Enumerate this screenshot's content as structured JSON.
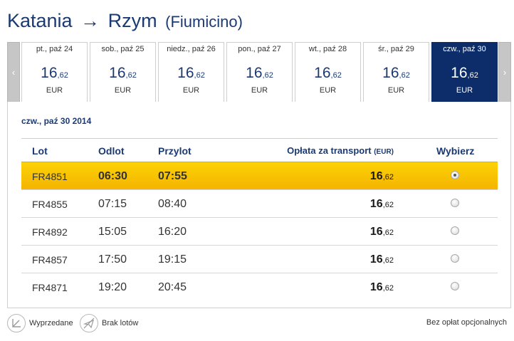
{
  "route": {
    "origin": "Katania",
    "arrow": "→",
    "destination": "Rzym",
    "airport": "(Fiumicino)"
  },
  "date_strip": {
    "prev_label": "‹",
    "next_label": "›",
    "days": [
      {
        "label": "pt., paź 24",
        "price_int": "16",
        "price_dec": ",62",
        "currency": "EUR",
        "selected": false
      },
      {
        "label": "sob., paź 25",
        "price_int": "16",
        "price_dec": ",62",
        "currency": "EUR",
        "selected": false
      },
      {
        "label": "niedz., paź 26",
        "price_int": "16",
        "price_dec": ",62",
        "currency": "EUR",
        "selected": false
      },
      {
        "label": "pon., paź 27",
        "price_int": "16",
        "price_dec": ",62",
        "currency": "EUR",
        "selected": false
      },
      {
        "label": "wt., paź 28",
        "price_int": "16",
        "price_dec": ",62",
        "currency": "EUR",
        "selected": false
      },
      {
        "label": "śr., paź 29",
        "price_int": "16",
        "price_dec": ",62",
        "currency": "EUR",
        "selected": false
      },
      {
        "label": "czw., paź 30",
        "price_int": "16",
        "price_dec": ",62",
        "currency": "EUR",
        "selected": true
      }
    ]
  },
  "results": {
    "date_heading": "czw., paź 30 2014",
    "headers": {
      "flight": "Lot",
      "departure": "Odlot",
      "arrival": "Przylot",
      "fare": "Opłata za transport",
      "fare_currency": "(EUR)",
      "select": "Wybierz"
    },
    "flights": [
      {
        "number": "FR4851",
        "departure": "06:30",
        "arrival": "07:55",
        "fare_int": "16",
        "fare_dec": ",62",
        "selected": true
      },
      {
        "number": "FR4855",
        "departure": "07:15",
        "arrival": "08:40",
        "fare_int": "16",
        "fare_dec": ",62",
        "selected": false
      },
      {
        "number": "FR4892",
        "departure": "15:05",
        "arrival": "16:20",
        "fare_int": "16",
        "fare_dec": ",62",
        "selected": false
      },
      {
        "number": "FR4857",
        "departure": "17:50",
        "arrival": "19:15",
        "fare_int": "16",
        "fare_dec": ",62",
        "selected": false
      },
      {
        "number": "FR4871",
        "departure": "19:20",
        "arrival": "20:45",
        "fare_int": "16",
        "fare_dec": ",62",
        "selected": false
      }
    ]
  },
  "legend": {
    "sold_out": "Wyprzedane",
    "sold_out_icon": "sold-out-icon",
    "no_flights": "Brak lotów",
    "no_flights_icon": "plane-icon",
    "no_fees_note": "Bez opłat opcjonalnych"
  },
  "colors": {
    "brand_navy": "#0c2d69",
    "heading_blue": "#1b3a72",
    "selected_row_yellow": "#f5b400"
  }
}
